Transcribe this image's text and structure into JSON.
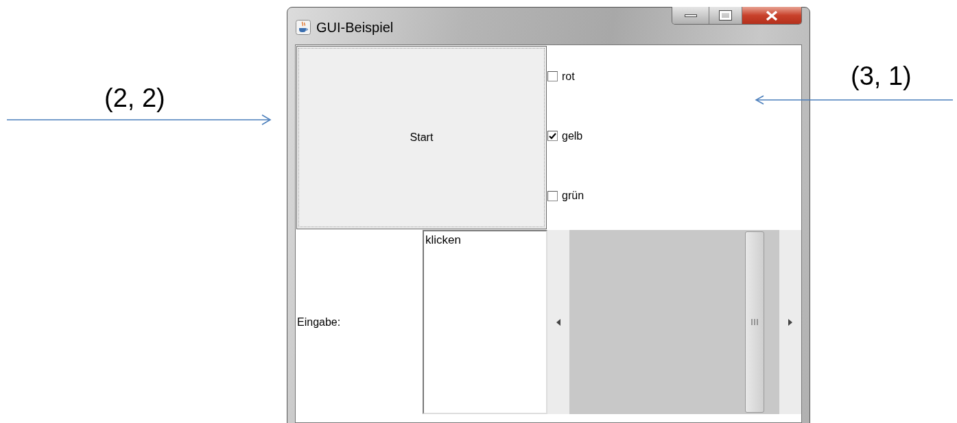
{
  "annotations": [
    {
      "label": "(2, 2)",
      "kind": "left"
    },
    {
      "label": "(3, 1)",
      "kind": "right"
    }
  ],
  "window": {
    "title": "GUI-Beispiel"
  },
  "start_button": {
    "label": "Start"
  },
  "checkboxes": [
    {
      "label": "rot",
      "checked": false
    },
    {
      "label": "gelb",
      "checked": true
    },
    {
      "label": "grün",
      "checked": false
    }
  ],
  "input_label": "Eingabe:",
  "text_area": {
    "value": "klicken"
  }
}
